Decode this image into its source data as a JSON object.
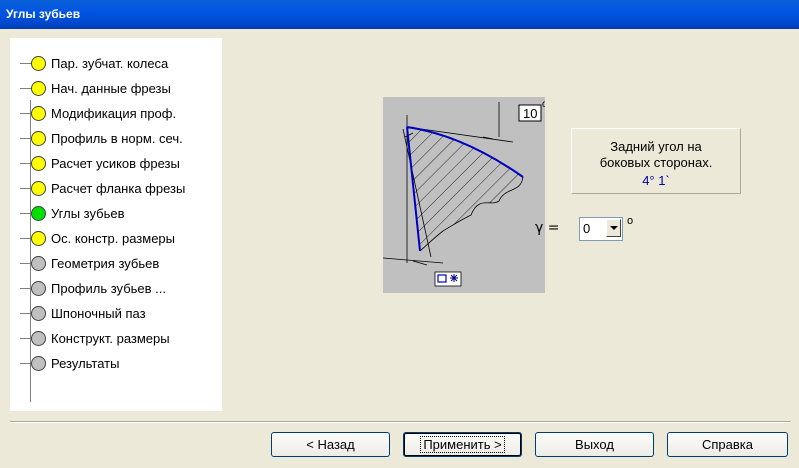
{
  "window": {
    "title": "Углы зубьев"
  },
  "tree": {
    "items": [
      {
        "label": "Пар. зубчат. колеса",
        "status": "yellow"
      },
      {
        "label": "Нач. данные фрезы",
        "status": "yellow"
      },
      {
        "label": "Модификация проф.",
        "status": "yellow"
      },
      {
        "label": "Профиль в норм. сеч.",
        "status": "yellow"
      },
      {
        "label": "Расчет усиков фрезы",
        "status": "yellow"
      },
      {
        "label": "Расчет фланка фрезы",
        "status": "yellow"
      },
      {
        "label": "Углы зубьев",
        "status": "green"
      },
      {
        "label": "Ос. констр. размеры",
        "status": "yellow"
      },
      {
        "label": "Геометрия зубьев",
        "status": "gray"
      },
      {
        "label": "Профиль зубьев ...",
        "status": "gray"
      },
      {
        "label": "Шпоночный паз",
        "status": "gray"
      },
      {
        "label": "Конструкт. размеры",
        "status": "gray"
      },
      {
        "label": "Результаты",
        "status": "gray"
      }
    ],
    "status_colors": {
      "yellow": "#FFFF00",
      "green": "#00E000",
      "gray": "#C0C0C0"
    }
  },
  "drawing": {
    "angle_value": "10",
    "degree_mark": "o"
  },
  "info": {
    "line1": "Задний угол на",
    "line2": "боковых сторонах.",
    "value": "4° 1`"
  },
  "gamma": {
    "label": "γ =",
    "value": "0",
    "unit": "o"
  },
  "buttons": {
    "back": "< Назад",
    "apply": "Применить >",
    "exit": "Выход",
    "help": "Справка"
  }
}
